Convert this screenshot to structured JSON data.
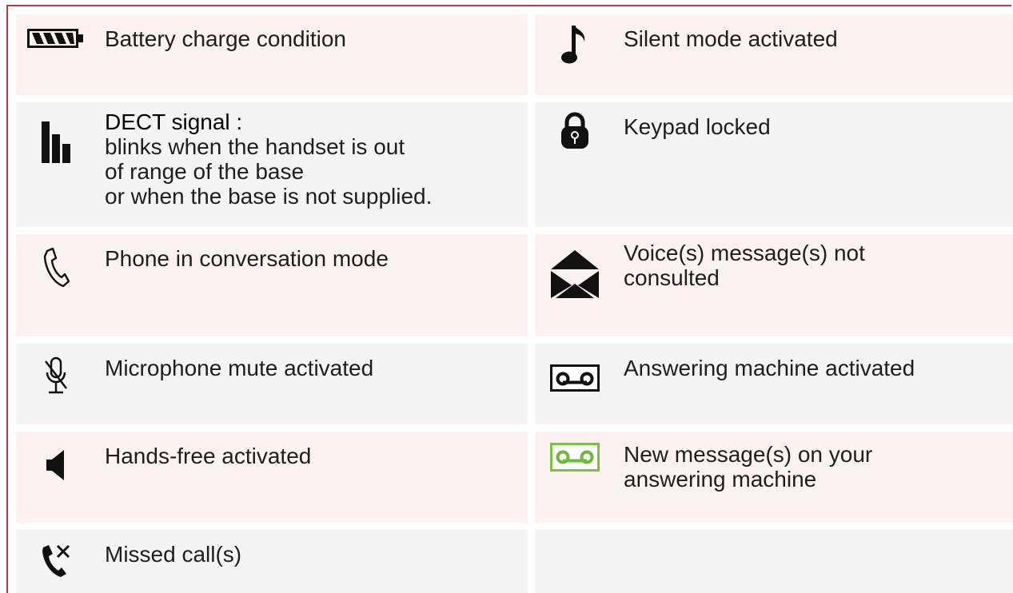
{
  "colors": {
    "frame": "#c8323c",
    "pink_row": "#fdf1f2",
    "gray_row": "#f4f4f4",
    "new_message_accent": "#7cc242"
  },
  "rows": [
    {
      "left": {
        "icon": "battery-icon",
        "text": "Battery charge condition"
      },
      "right": {
        "icon": "silent-mode-note-icon",
        "text": "Silent mode activated"
      }
    },
    {
      "left": {
        "icon": "dect-signal-bars-icon",
        "title": "DECT signal :",
        "lines": [
          "blinks when the handset is out",
          "of range of the base",
          "or when the base is not supplied."
        ]
      },
      "right": {
        "icon": "padlock-icon",
        "text": "Keypad locked"
      }
    },
    {
      "left": {
        "icon": "phone-handset-icon",
        "text": "Phone in conversation mode"
      },
      "right": {
        "icon": "envelope-icon",
        "lines": [
          "Voice(s) message(s) not",
          "consulted"
        ]
      }
    },
    {
      "left": {
        "icon": "microphone-muted-icon",
        "text": "Microphone mute activated"
      },
      "right": {
        "icon": "answering-machine-icon",
        "text": "Answering machine activated"
      }
    },
    {
      "left": {
        "icon": "speaker-icon",
        "text": "Hands-free activated"
      },
      "right": {
        "icon": "answering-machine-new-message-icon",
        "lines": [
          "New message(s) on your",
          "answering machine"
        ]
      }
    },
    {
      "left": {
        "icon": "missed-call-icon",
        "text": "Missed call(s)"
      },
      "right": {
        "icon": "",
        "text": ""
      }
    }
  ]
}
